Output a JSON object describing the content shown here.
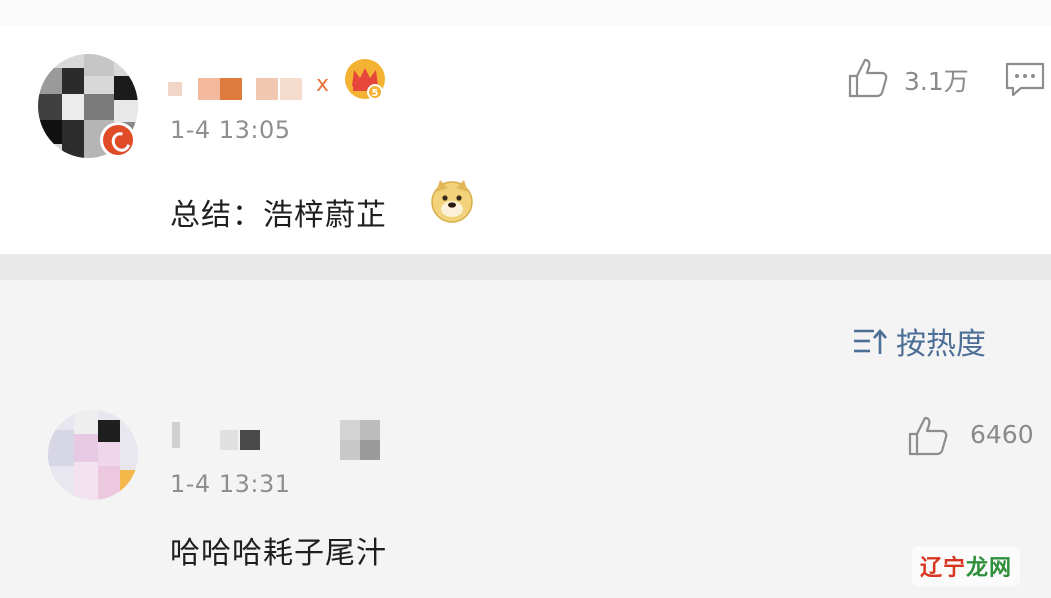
{
  "comment_top": {
    "username_suffix": "x",
    "timestamp": "1-4 13:05",
    "text": "总结：浩梓蔚芷",
    "likes": "3.1万",
    "icons": [
      "avatar-blurred",
      "vip-crown-icon",
      "doge-emoji-icon",
      "thumbs-up-icon",
      "reply-icon"
    ]
  },
  "sort": {
    "label": "按热度",
    "icon": "sort-icon"
  },
  "comment_reply": {
    "timestamp": "1-4 13:31",
    "text": "哈哈哈耗子尾汁",
    "likes": "6460",
    "icons": [
      "avatar-blurred",
      "thumbs-up-icon"
    ]
  },
  "watermark": {
    "part_a": "辽宁",
    "part_b": "龙网"
  },
  "colors": {
    "sort_text": "#4d6e96",
    "meta_gray": "#8f8f8f",
    "crown": "#f3b232"
  }
}
